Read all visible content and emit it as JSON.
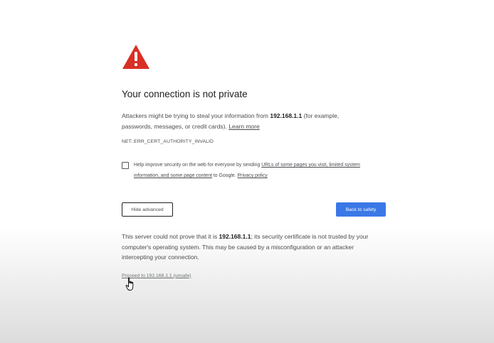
{
  "heading": "Your connection is not private",
  "message": {
    "prefix": "Attackers might be trying to steal your information from ",
    "host": "192.168.1.1",
    "suffix": " (for example, passwords, messages, or credit cards). ",
    "learn_more": "Learn more"
  },
  "error_code": "NET::ERR_CERT_AUTHORITY_INVALID",
  "checkbox": {
    "checked": false,
    "text_prefix": "Help improve security on the web for everyone by sending ",
    "link1": "URLs of some pages you visit, limited system information, and some page content",
    "text_middle": " to Google. ",
    "link2": "Privacy policy"
  },
  "buttons": {
    "hide_advanced": "Hide advanced",
    "back_to_safety": "Back to safety"
  },
  "details": {
    "prefix": "This server could not prove that it is ",
    "host": "192.168.1.1",
    "suffix": "; its security certificate is not trusted by your computer's operating system. This may be caused by a misconfiguration or an attacker intercepting your connection."
  },
  "proceed_link": "Proceed to 192.168.1.1 (unsafe)",
  "colors": {
    "warning_red": "#d93025",
    "primary_blue": "#3b78e7"
  },
  "icons": {
    "warning": "warning-triangle-icon",
    "cursor": "hand-pointer-icon"
  }
}
